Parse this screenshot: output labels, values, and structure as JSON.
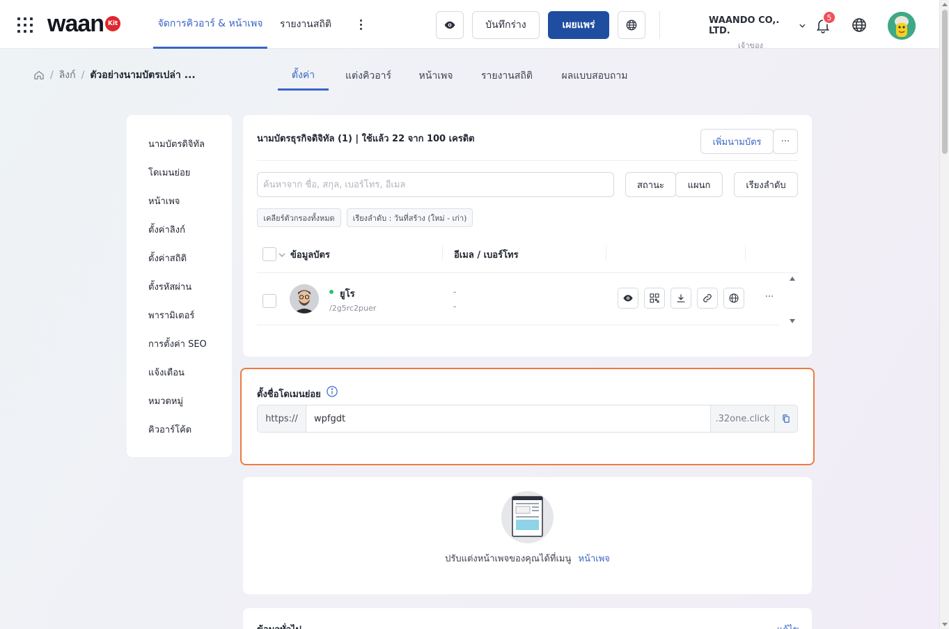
{
  "header": {
    "logo_text": "waan",
    "logo_badge": "Kit",
    "nav_tabs": [
      {
        "label": "จัดการคิวอาร์ & หน้าเพจ",
        "active": true
      },
      {
        "label": "รายงานสถิติ",
        "active": false
      }
    ],
    "save_draft_label": "บันทึกร่าง",
    "publish_label": "เผยแพร่",
    "company_name": "WAANDO CO,. LTD.",
    "company_role": "เจ้าของ",
    "notification_count": "5"
  },
  "breadcrumb": {
    "items": [
      "ลิงก์",
      "ตัวอย่างนามบัตรเปล่า ..."
    ]
  },
  "sub_tabs": [
    {
      "label": "ตั้งค่า",
      "active": true
    },
    {
      "label": "แต่งคิวอาร์",
      "active": false
    },
    {
      "label": "หน้าเพจ",
      "active": false
    },
    {
      "label": "รายงานสถิติ",
      "active": false
    },
    {
      "label": "ผลแบบสอบถาม",
      "active": false
    }
  ],
  "side_menu": [
    "นามบัตรดิจิทัล",
    "โดเมนย่อย",
    "หน้าเพจ",
    "ตั้งค่าลิงก์",
    "ตั้งค่าสถิติ",
    "ตั้งรหัสผ่าน",
    "พารามิเตอร์",
    "การตั้งค่า SEO",
    "แจ้งเตือน",
    "หมวดหมู่",
    "คิวอาร์โค้ด"
  ],
  "cards_panel": {
    "title": "นามบัตรธุรกิจดิจิทัล (1) | ใช้แล้ว 22 จาก 100 เครดิต",
    "add_button": "เพิ่มนามบัตร",
    "more_button": "···",
    "search_placeholder": "ค้นหาจาก ชื่อ, สกุล, เบอร์โทร, อีเมล",
    "filter_status": "สถานะ",
    "filter_department": "แผนก",
    "sort_button": "เรียงลำดับ",
    "chip_clear": "เคลียร์ตัวกรองทั้งหมด",
    "chip_sort": "เรียงลำดับ : วันที่สร้าง (ใหม่ - เก่า)",
    "columns": [
      "ข้อมูลบัตร",
      "อีเมล / เบอร์โทร"
    ],
    "rows": [
      {
        "name": "ยูโร",
        "slug": "/2g5rc2puer",
        "email": "-",
        "phone": "-",
        "status_color": "#2fbf71"
      }
    ],
    "row_more": "···"
  },
  "subdomain": {
    "title": "ตั้งชื่อโดเมนย่อย",
    "prefix": "https://",
    "value": "wpfgdt",
    "suffix": ".32one.click"
  },
  "page_card": {
    "text": "ปรับแต่งหน้าเพจของคุณได้ที่เมนู",
    "link": "หน้าเพจ"
  },
  "general_card": {
    "title": "ข้อมูลทั่วไป",
    "edit": "แก้ไข"
  },
  "colors": {
    "accent": "#3a64c8",
    "primary_button": "#1f4ea0",
    "highlight_border": "#ee7a40",
    "badge": "#f0505a"
  }
}
